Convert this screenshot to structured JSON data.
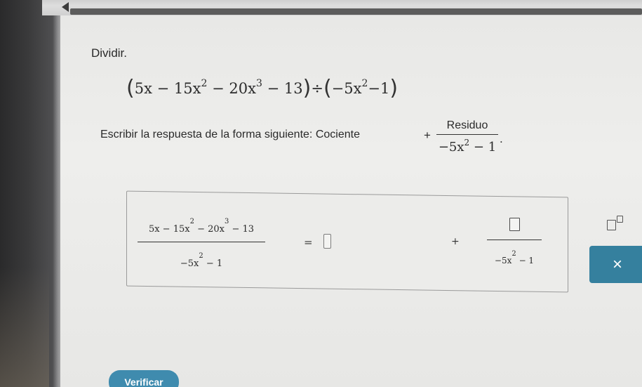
{
  "nav": {
    "back_icon": "back-arrow-icon"
  },
  "problem": {
    "heading": "Dividir.",
    "dividend": {
      "t1": "5x",
      "op1": "−",
      "t2_coef": "15x",
      "t2_exp": "2",
      "op2": "−",
      "t3_coef": "20x",
      "t3_exp": "3",
      "op3": "−",
      "t4": "13"
    },
    "divide_symbol": "÷",
    "divisor": {
      "t1_coef": "−5x",
      "t1_exp": "2",
      "op": "−",
      "t2": "1"
    }
  },
  "instruction": {
    "text": "Escribir la respuesta de la forma siguiente: Cociente",
    "plus": "+",
    "numerator": "Residuo",
    "denominator_coef": "−5x",
    "denominator_exp": "2",
    "denominator_rest": " − 1",
    "period": "."
  },
  "answer": {
    "lhs_numerator": {
      "a": "5x − 15x",
      "e1": "2",
      "b": " − 20x",
      "e2": "3",
      "c": " − 13"
    },
    "lhs_denominator": {
      "a": "−5x",
      "e": "2",
      "b": " − 1"
    },
    "equals": "=",
    "plus": "+",
    "rhs_denominator": {
      "a": "−5x",
      "e": "2",
      "b": " − 1"
    }
  },
  "toolbar": {
    "exponent_icon": "exponent-template-icon",
    "clear_label": "×"
  },
  "footer": {
    "verify_label": "Verificar"
  }
}
